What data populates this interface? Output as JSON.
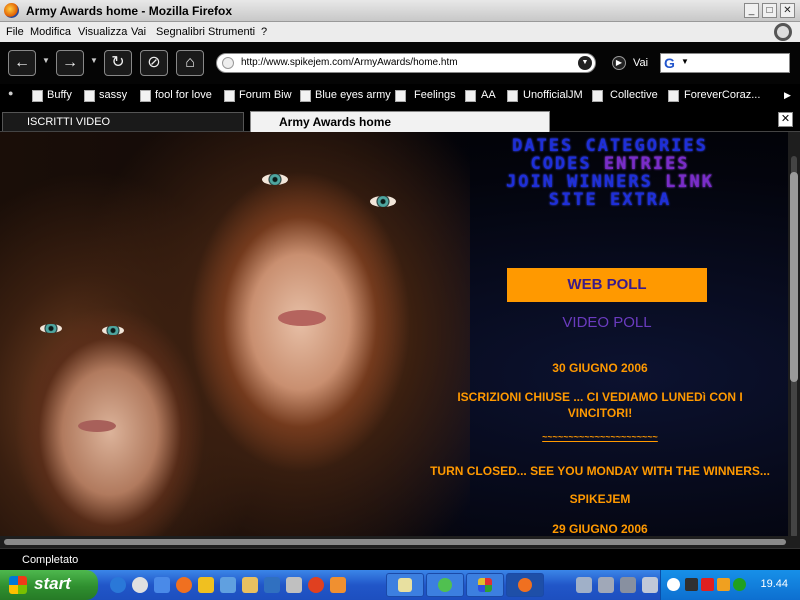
{
  "window": {
    "title": "Army Awards home - Mozilla Firefox",
    "minimize": "_",
    "maximize": "□",
    "close": "✕"
  },
  "menu": [
    "File",
    "Modifica",
    "Visualizza",
    "Vai",
    "Segnalibri",
    "Strumenti",
    "?"
  ],
  "nav": {
    "url": "http://www.spikejem.com/ArmyAwards/home.htm",
    "go_label": "Vai",
    "search_engine": "G"
  },
  "bookmarks": [
    "Buffy",
    "sassy",
    "fool for love",
    "Forum Biw",
    "Blue eyes army",
    "Feelings",
    "AA",
    "UnofficialJM",
    "Collective",
    "ForeverCoraz..."
  ],
  "tabs": [
    {
      "label": "ISCRITTI VIDEO",
      "active": false
    },
    {
      "label": "Army Awards home",
      "active": true
    }
  ],
  "page": {
    "site_nav": {
      "row1": [
        "DATES",
        "CATEGORIES"
      ],
      "row2": [
        "CODES",
        "ENTRIES"
      ],
      "row3": [
        "JOIN",
        "WINNERS",
        "LINK"
      ],
      "row4": [
        "SITE",
        "EXTRA"
      ]
    },
    "web_poll": "WEB POLL",
    "video_poll": "VIDEO POLL",
    "news": {
      "date1": "30 GIUGNO 2006",
      "it_line1": "ISCRIZIONI CHIUSE ... CI VEDIAMO LUNEDì CON I",
      "it_line2": "VINCITORI!",
      "separator": "~~~~~~~~~~~~~~~~~~~~~~",
      "en": "TURN CLOSED... SEE YOU MONDAY WITH THE WINNERS...",
      "signature": "SPIKEJEM",
      "date2": "29 GIUGNO 2006"
    }
  },
  "status": {
    "text": "Completato"
  },
  "taskbar": {
    "start_label": "start",
    "clock": "19.44"
  },
  "colors": {
    "nav_blue": "#1e2fd8",
    "nav_purple": "#7a2cc8",
    "accent_orange": "#ff9900"
  }
}
